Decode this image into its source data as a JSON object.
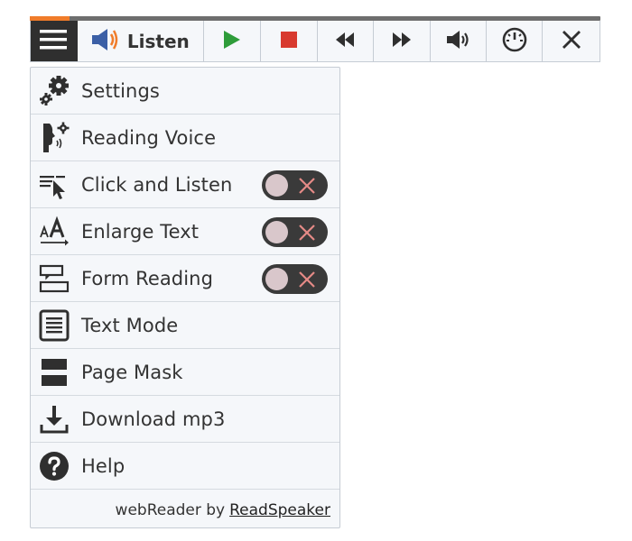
{
  "progress": {
    "fraction": 0.07,
    "track_color": "#6e6e6e",
    "fill_color": "#f07c2a"
  },
  "toolbar": {
    "menu_icon": "hamburger-icon",
    "listen_icon": "speaker-icon",
    "listen_label": "Listen",
    "buttons": [
      {
        "name": "play-button",
        "icon": "play-icon",
        "color": "#2e9c3a"
      },
      {
        "name": "stop-button",
        "icon": "stop-icon",
        "color": "#d83a2f"
      },
      {
        "name": "rewind-button",
        "icon": "rewind-icon"
      },
      {
        "name": "fast-forward-button",
        "icon": "fast-forward-icon"
      },
      {
        "name": "volume-button",
        "icon": "volume-icon"
      },
      {
        "name": "speed-button",
        "icon": "speedometer-icon"
      },
      {
        "name": "close-button",
        "icon": "close-icon"
      }
    ]
  },
  "menu": {
    "items": [
      {
        "label": "Settings",
        "icon": "gears-icon"
      },
      {
        "label": "Reading Voice",
        "icon": "voice-icon"
      },
      {
        "label": "Click and Listen",
        "icon": "click-listen-icon",
        "toggle": false
      },
      {
        "label": "Enlarge Text",
        "icon": "enlarge-text-icon",
        "toggle": false
      },
      {
        "label": "Form Reading",
        "icon": "form-reading-icon",
        "toggle": false
      },
      {
        "label": "Text Mode",
        "icon": "text-mode-icon"
      },
      {
        "label": "Page Mask",
        "icon": "page-mask-icon"
      },
      {
        "label": "Download mp3",
        "icon": "download-icon"
      },
      {
        "label": "Help",
        "icon": "help-icon"
      }
    ],
    "footer": {
      "prefix": "webReader by",
      "link": "ReadSpeaker"
    }
  }
}
